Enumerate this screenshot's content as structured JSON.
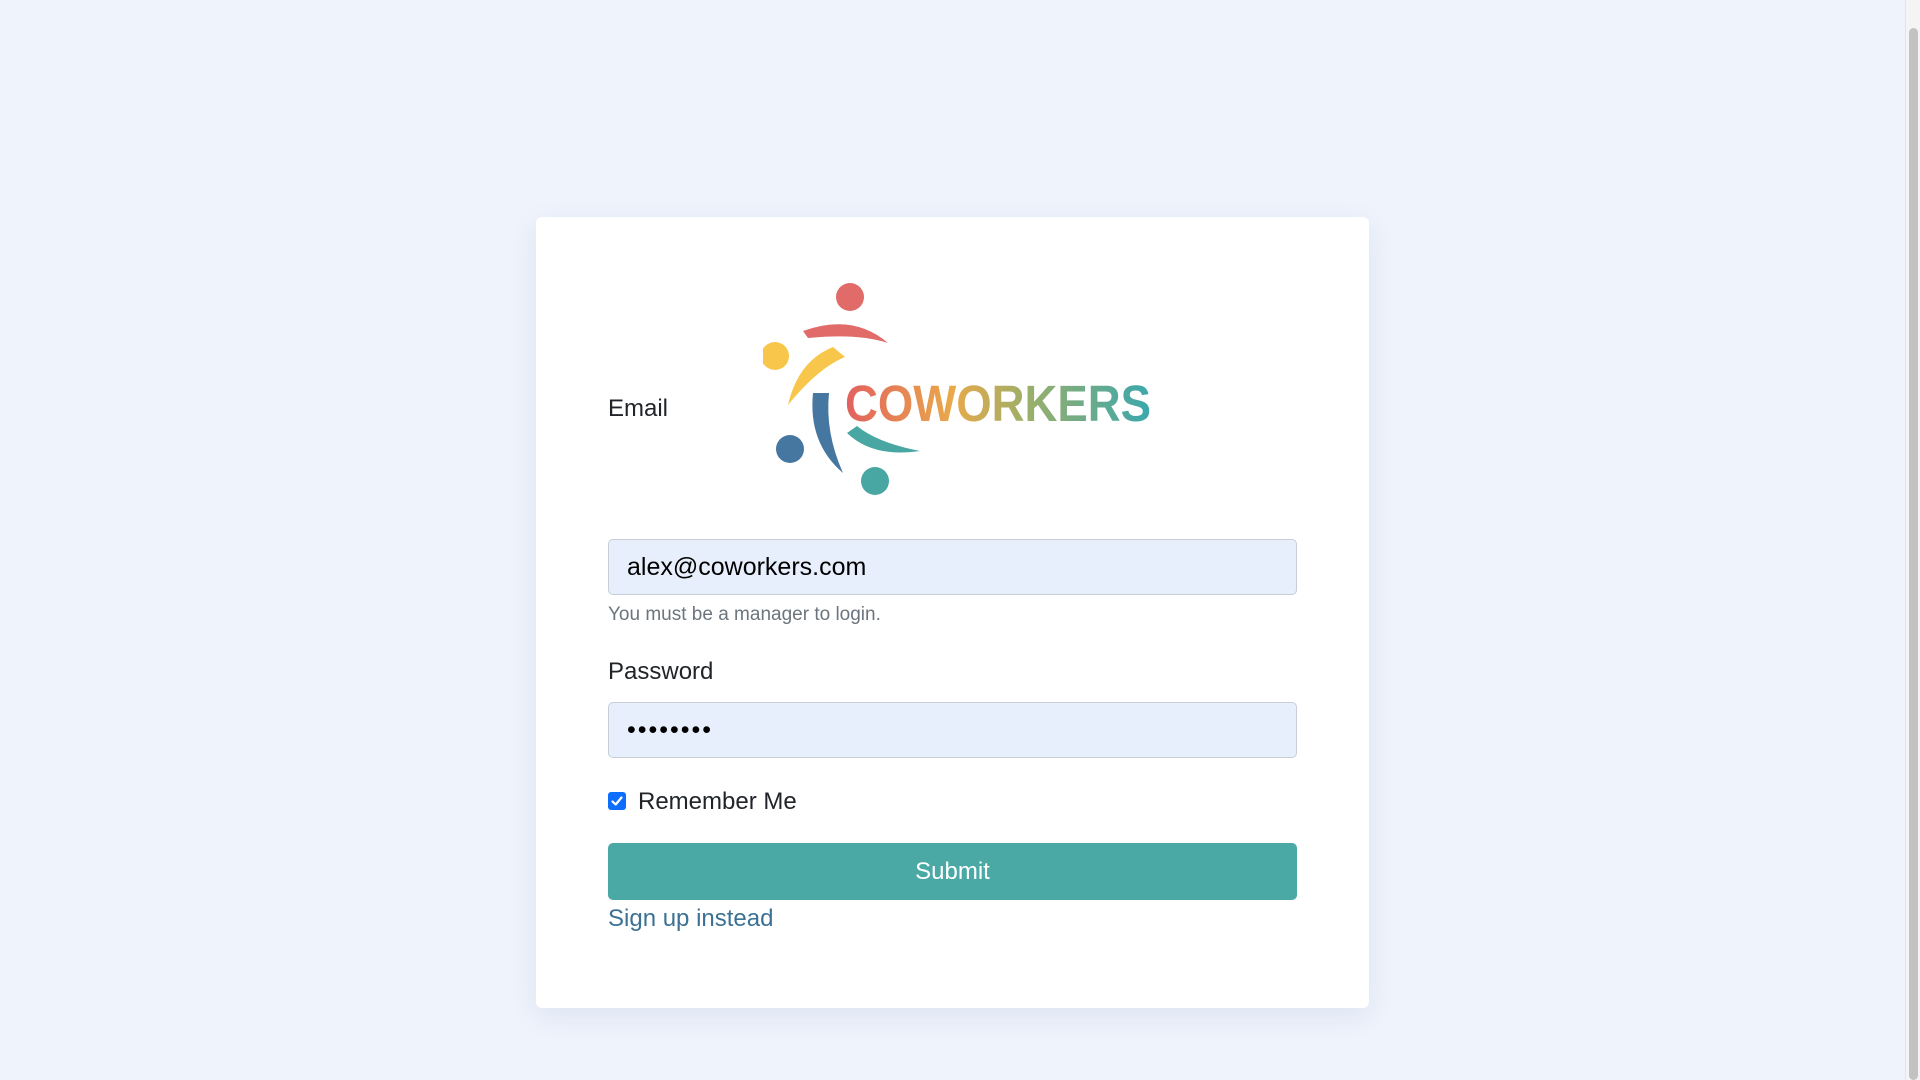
{
  "brand": {
    "logo_text": "COWORKERS",
    "logo_icon": "coworkers-people-circle-logo"
  },
  "form": {
    "email_label": "Email",
    "email_value": "alex@coworkers.com",
    "email_help": "You must be a manager to login.",
    "password_label": "Password",
    "password_value": "••••••••",
    "remember_label": "Remember Me",
    "remember_checked": true,
    "submit_label": "Submit",
    "signup_link": "Sign up instead"
  },
  "colors": {
    "page_background": "#eef3fc",
    "primary": "#4aa9a5",
    "link": "#3c7193",
    "checkbox": "#0d6efd"
  }
}
